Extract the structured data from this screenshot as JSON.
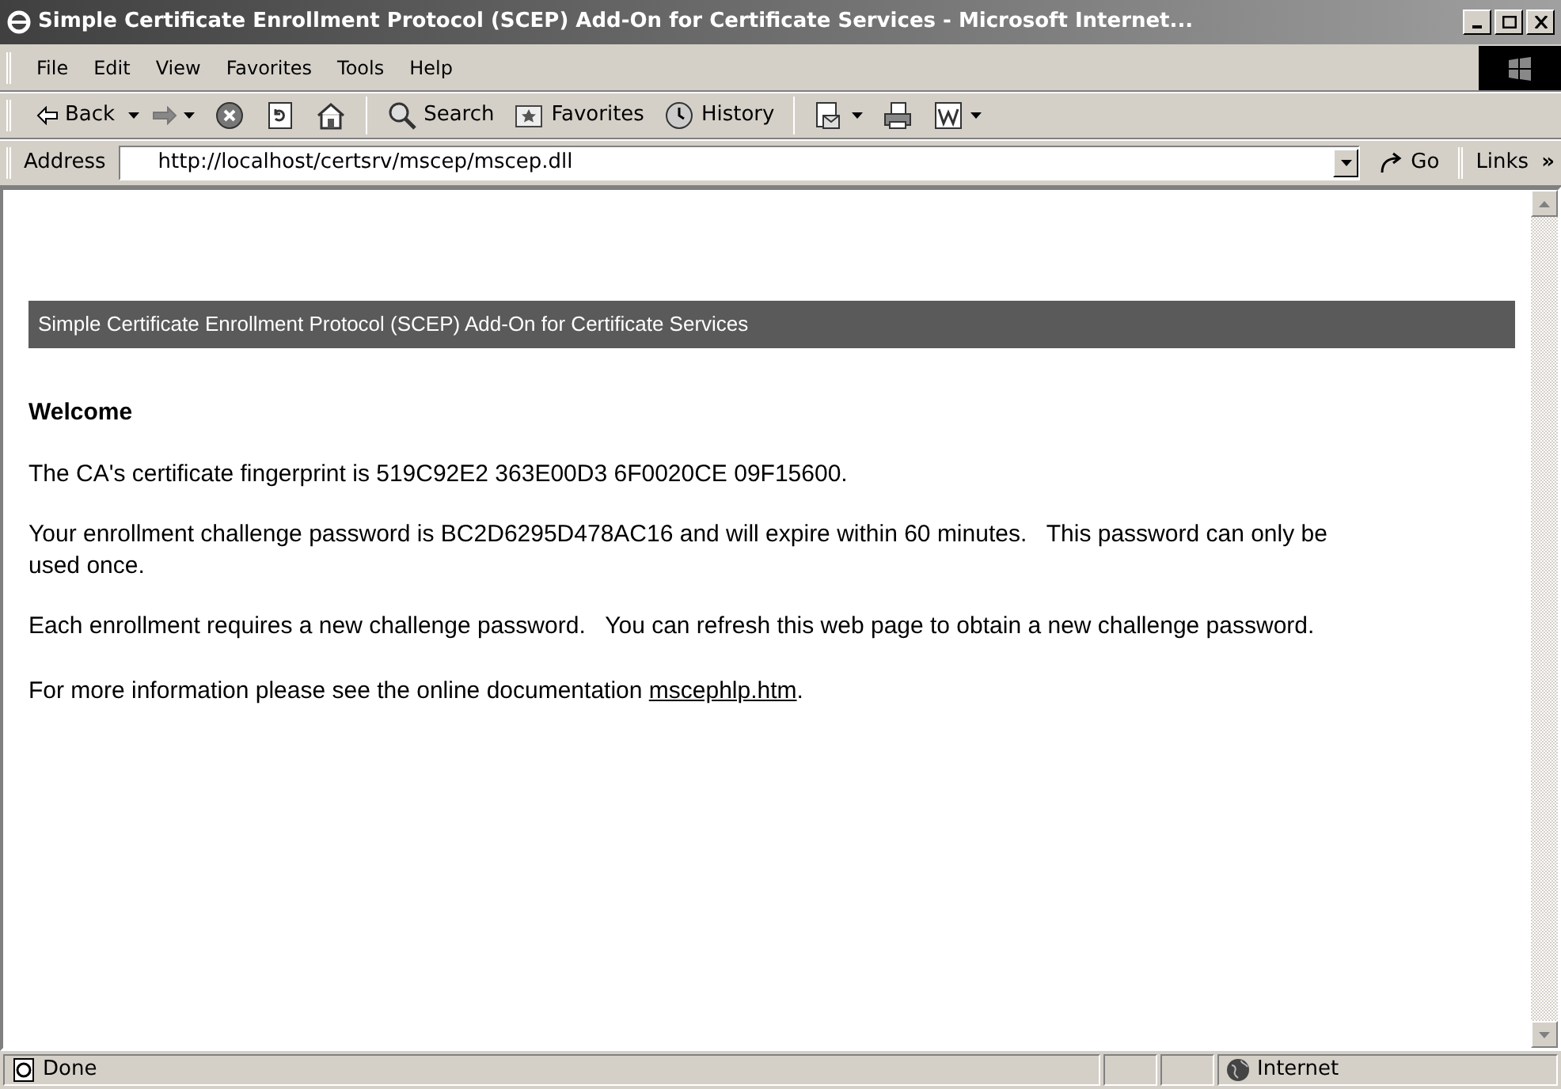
{
  "window": {
    "title": "Simple Certificate Enrollment Protocol (SCEP) Add-On for Certificate Services - Microsoft Internet..."
  },
  "menu": [
    "File",
    "Edit",
    "View",
    "Favorites",
    "Tools",
    "Help"
  ],
  "toolbar": [
    {
      "kind": "back",
      "label": "Back"
    },
    {
      "kind": "forward"
    },
    {
      "kind": "stop"
    },
    {
      "kind": "refresh"
    },
    {
      "kind": "home"
    },
    {
      "kind": "sep"
    },
    {
      "kind": "search",
      "label": "Search"
    },
    {
      "kind": "favorites",
      "label": "Favorites"
    },
    {
      "kind": "history",
      "label": "History"
    },
    {
      "kind": "sep"
    },
    {
      "kind": "mail"
    },
    {
      "kind": "print"
    },
    {
      "kind": "edit"
    }
  ],
  "address": {
    "label": "Address",
    "value": "http://localhost/certsrv/mscep/mscep.dll",
    "go": "Go",
    "links": "Links",
    "more": "»"
  },
  "page": {
    "banner": "Simple Certificate Enrollment Protocol (SCEP) Add-On for Certificate Services",
    "heading": "Welcome",
    "paragraphs": [
      "The CA's certificate fingerprint is 519C92E2 363E00D3 6F0020CE 09F15600.",
      "Your enrollment challenge password is BC2D6295D478AC16 and will expire within 60 minutes.   This password can only be used once.",
      "Each enrollment requires a new challenge password.   You can refresh this web page to obtain a new challenge password."
    ],
    "info": {
      "text": "For more information please see the online documentation ",
      "link": "mscephlp.htm",
      "end": "."
    }
  },
  "status_bar": {
    "text": "Done",
    "zone": "Internet"
  }
}
